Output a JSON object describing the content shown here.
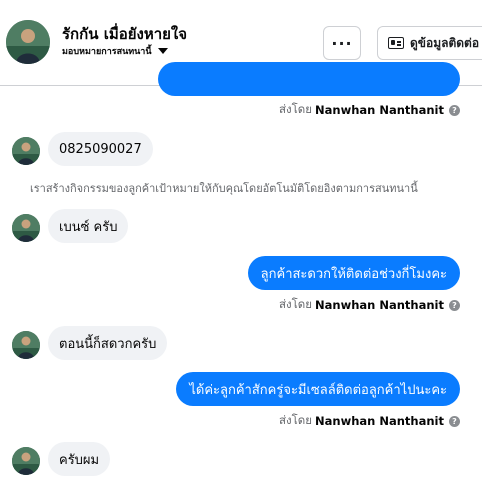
{
  "header": {
    "contact_name": "รักกัน เมื่อยังหายใจ",
    "assignment_label": "มอบหมายการสนทนานี้",
    "more_button_label": "···",
    "info_button_label": "ดูข้อมูลติดต่อ"
  },
  "messages": [
    {
      "direction": "outgoing",
      "text": ""
    },
    {
      "direction": "outgoing-meta",
      "sent_by_prefix": "ส่งโดย",
      "sent_by_name": "Nanwhan Nanthanit"
    },
    {
      "direction": "incoming",
      "text": "0825090027"
    },
    {
      "direction": "system",
      "text": "เราสร้างกิจกรรมของลูกค้าเป้าหมายให้กับคุณโดยอัตโนมัติโดยอิงตามการสนทนานี้"
    },
    {
      "direction": "incoming",
      "text": "เบนซ์ ครับ"
    },
    {
      "direction": "outgoing",
      "text": "ลูกค้าสะดวกให้ติดต่อช่วงกี่โมงคะ"
    },
    {
      "direction": "outgoing-meta",
      "sent_by_prefix": "ส่งโดย",
      "sent_by_name": "Nanwhan Nanthanit"
    },
    {
      "direction": "incoming",
      "text": "ตอนนี้ก็สดวกครับ"
    },
    {
      "direction": "outgoing",
      "text": "ได้ค่ะลูกค้าสักครู่จะมีเซลล์ติดต่อลูกค้าไปนะคะ"
    },
    {
      "direction": "outgoing-meta",
      "sent_by_prefix": "ส่งโดย",
      "sent_by_name": "Nanwhan Nanthanit"
    },
    {
      "direction": "incoming",
      "text": "ครับผม"
    }
  ],
  "colors": {
    "outgoing_bubble": "#0a7cff",
    "incoming_bubble": "#f0f2f5",
    "meta_text": "#65676b"
  }
}
